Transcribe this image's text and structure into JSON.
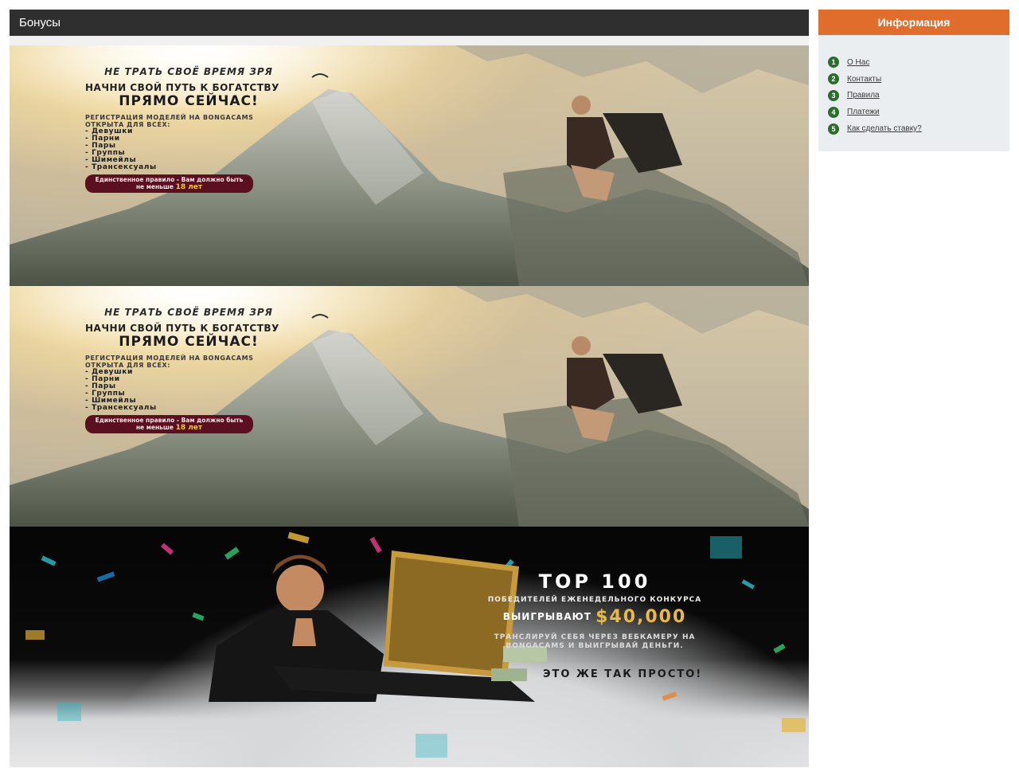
{
  "main": {
    "title": "Бонусы"
  },
  "banners": [
    {
      "line1": "НЕ ТРАТЬ СВОЁ ВРЕМЯ ЗРЯ",
      "line2": "НАЧНИ СВОЙ ПУТЬ К БОГАТСТВУ",
      "line3": "ПРЯМО СЕЙЧАС!",
      "reg": "РЕГИСТРАЦИЯ МОДЕЛЕЙ НА BONGACAMS ОТКРЫТА ДЛЯ ВСЕХ:",
      "list": [
        "- Девушки",
        "- Парни",
        "- Пары",
        "- Группы",
        "- Шимейлы",
        "- Трансексуалы"
      ],
      "rule": "Единственное правило - Вам должно быть не меньше",
      "age": "18 лет"
    },
    {
      "line1": "НЕ ТРАТЬ СВОЁ ВРЕМЯ ЗРЯ",
      "line2": "НАЧНИ СВОЙ ПУТЬ К БОГАТСТВУ",
      "line3": "ПРЯМО СЕЙЧАС!",
      "reg": "РЕГИСТРАЦИЯ МОДЕЛЕЙ НА BONGACAMS ОТКРЫТА ДЛЯ ВСЕХ:",
      "list": [
        "- Девушки",
        "- Парни",
        "- Пары",
        "- Группы",
        "- Шимейлы",
        "- Трансексуалы"
      ],
      "rule": "Единственное правило - Вам должно быть не меньше",
      "age": "18 лет"
    },
    {
      "top": "TOP 100",
      "sub": "ПОБЕДИТЕЛЕЙ ЕЖЕНЕДЕЛЬНОГО КОНКУРСА",
      "win": "ВЫИГРЫВАЮТ",
      "amount": "$40,000",
      "desc": "ТРАНСЛИРУЙ СЕБЯ ЧЕРЕЗ ВЕБКАМЕРУ НА BONGACAMS И ВЫИГРЫВАЙ ДЕНЬГИ.",
      "easy": "ЭТО ЖЕ ТАК ПРОСТО!"
    }
  ],
  "sidebar": {
    "title": "Информация",
    "items": [
      {
        "num": "1",
        "label": "О Нас"
      },
      {
        "num": "2",
        "label": "Контакты"
      },
      {
        "num": "3",
        "label": "Правила"
      },
      {
        "num": "4",
        "label": "Платежи"
      },
      {
        "num": "5",
        "label": "Как сделать ставку?"
      }
    ]
  }
}
